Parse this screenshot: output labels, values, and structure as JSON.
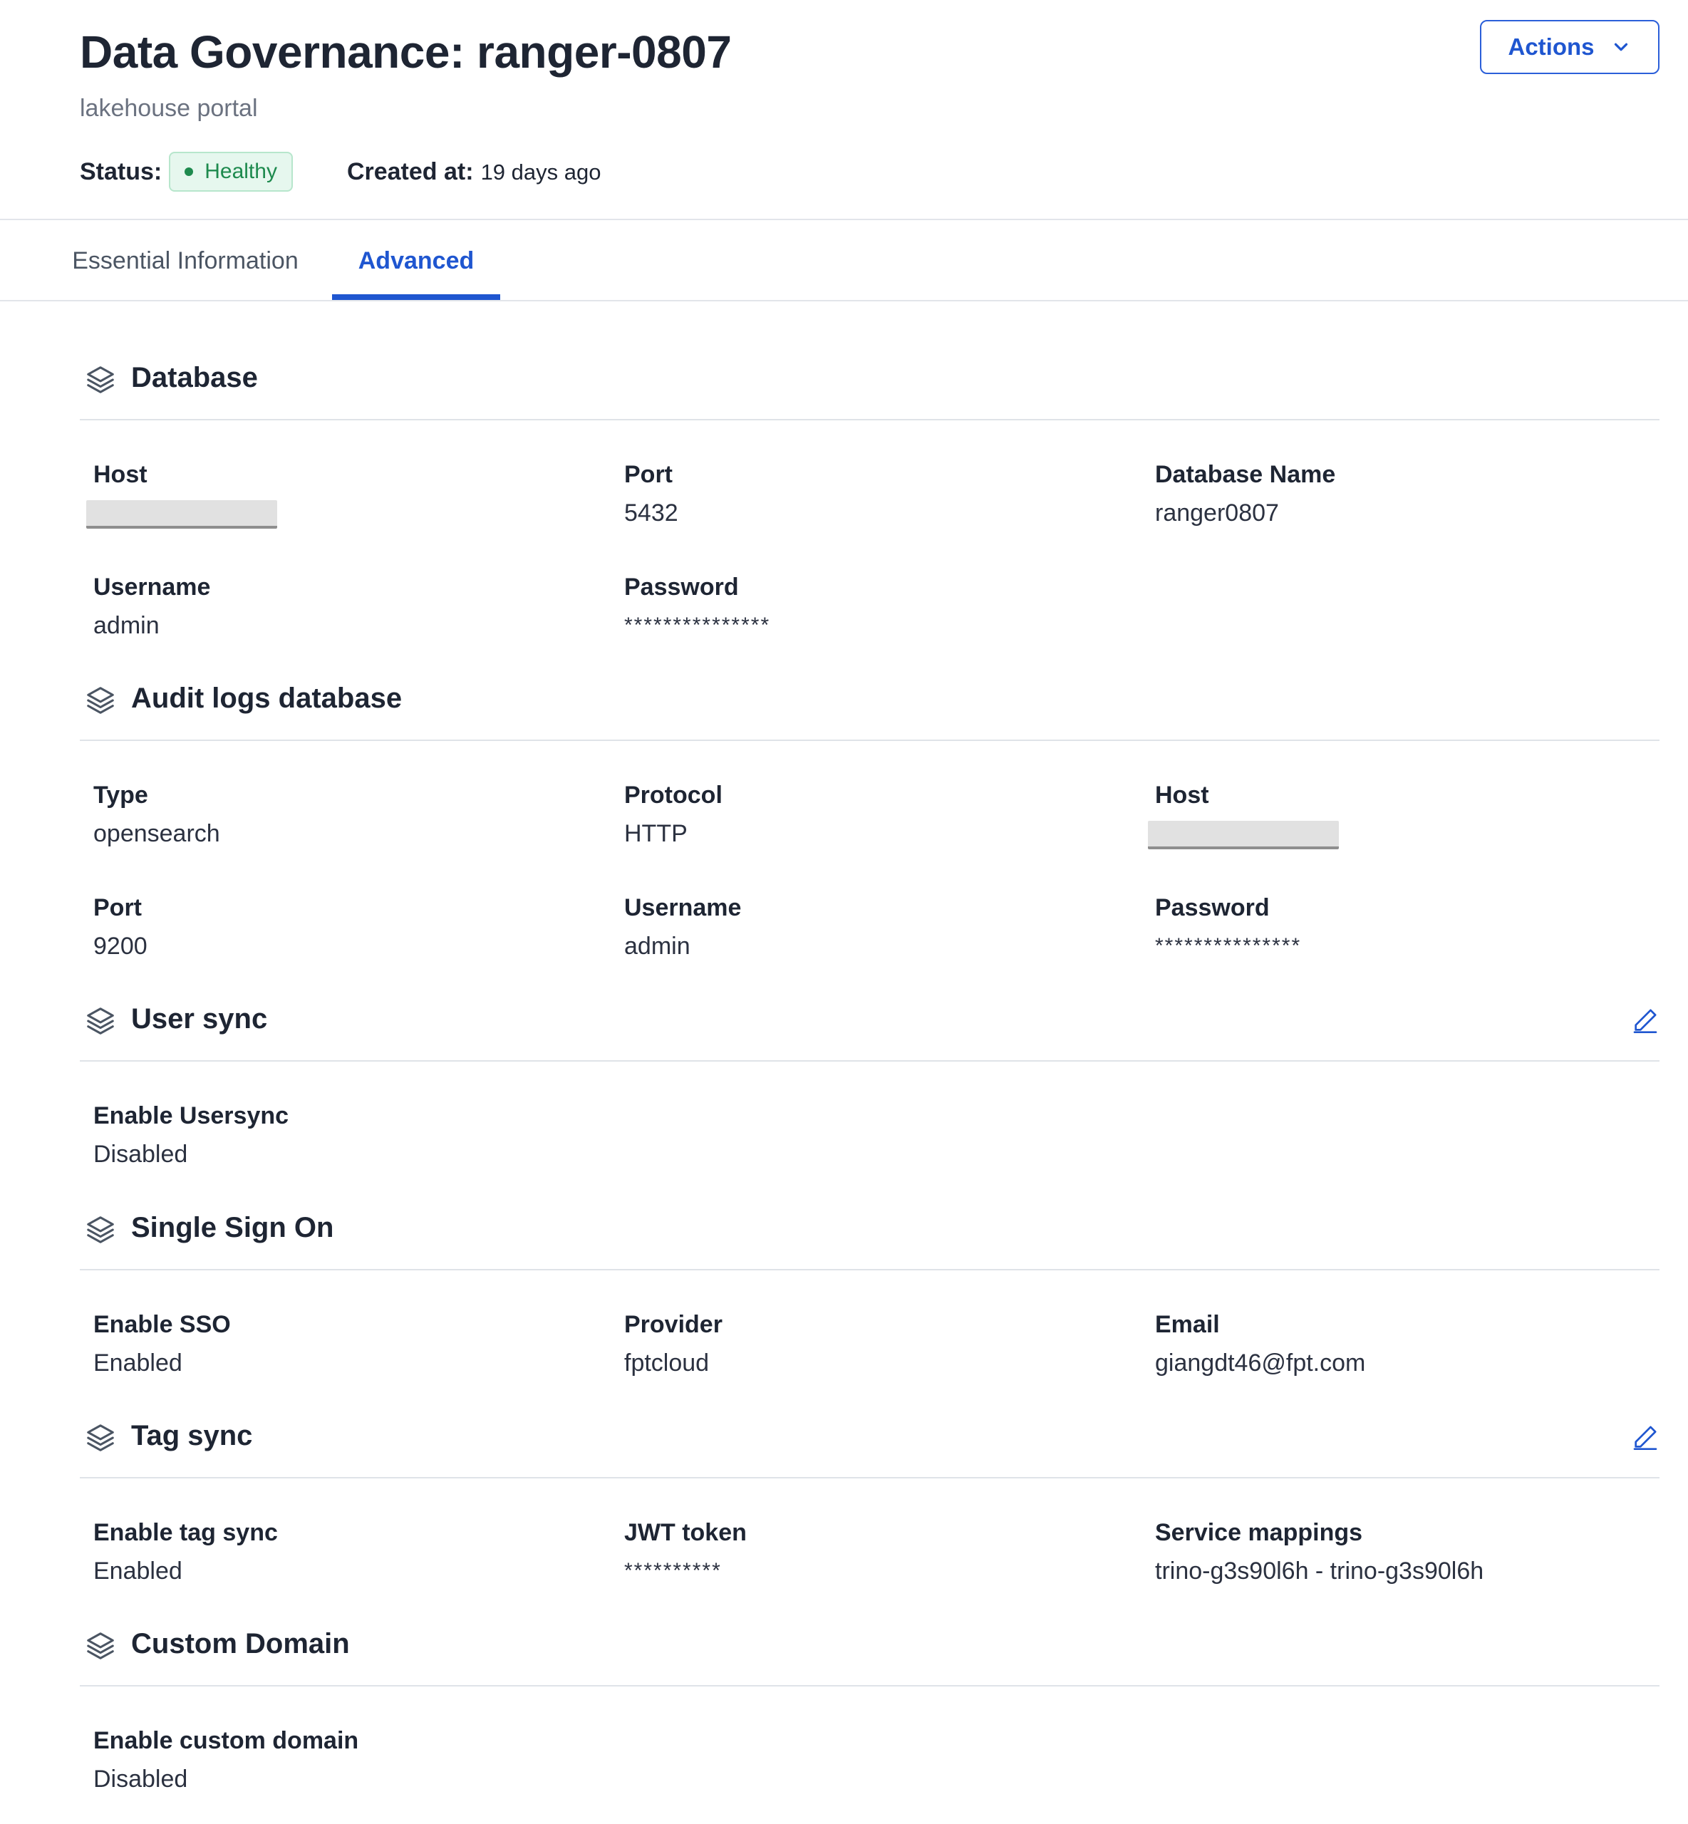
{
  "header": {
    "title": "Data Governance: ranger-0807",
    "subtitle": "lakehouse portal",
    "status_label": "Status:",
    "status_value": "Healthy",
    "created_label": "Created at:",
    "created_value": "19 days ago",
    "actions_label": "Actions"
  },
  "tabs": [
    {
      "label": "Essential Information",
      "active": false
    },
    {
      "label": "Advanced",
      "active": true
    }
  ],
  "sections": {
    "database": {
      "title": "Database",
      "fields": {
        "host": {
          "label": "Host",
          "value": ""
        },
        "port": {
          "label": "Port",
          "value": "5432"
        },
        "db_name": {
          "label": "Database Name",
          "value": "ranger0807"
        },
        "username": {
          "label": "Username",
          "value": "admin"
        },
        "password": {
          "label": "Password",
          "value": "***************"
        }
      }
    },
    "audit": {
      "title": "Audit logs database",
      "fields": {
        "type": {
          "label": "Type",
          "value": "opensearch"
        },
        "protocol": {
          "label": "Protocol",
          "value": "HTTP"
        },
        "host": {
          "label": "Host",
          "value": ""
        },
        "port": {
          "label": "Port",
          "value": "9200"
        },
        "username": {
          "label": "Username",
          "value": "admin"
        },
        "password": {
          "label": "Password",
          "value": "***************"
        }
      }
    },
    "user_sync": {
      "title": "User sync",
      "fields": {
        "enable": {
          "label": "Enable Usersync",
          "value": "Disabled"
        }
      }
    },
    "sso": {
      "title": "Single Sign On",
      "fields": {
        "enable": {
          "label": "Enable SSO",
          "value": "Enabled"
        },
        "provider": {
          "label": "Provider",
          "value": "fptcloud"
        },
        "email": {
          "label": "Email",
          "value": "giangdt46@fpt.com"
        }
      }
    },
    "tag_sync": {
      "title": "Tag sync",
      "fields": {
        "enable": {
          "label": "Enable tag sync",
          "value": "Enabled"
        },
        "jwt": {
          "label": "JWT token",
          "value": "**********"
        },
        "mappings": {
          "label": "Service mappings",
          "value": "trino-g3s90l6h - trino-g3s90l6h"
        }
      }
    },
    "custom_domain": {
      "title": "Custom Domain",
      "fields": {
        "enable": {
          "label": "Enable custom domain",
          "value": "Disabled"
        }
      }
    }
  },
  "colors": {
    "accent": "#1f56d0",
    "status_green": "#1e8a4e",
    "status_bg": "#e6f7ee",
    "text_dark": "#1e2533",
    "text_muted": "#6b7280",
    "divider": "#dfe3e8"
  },
  "icons": {
    "section": "layers-icon",
    "edit": "pencil-icon",
    "dropdown": "chevron-down-icon"
  }
}
